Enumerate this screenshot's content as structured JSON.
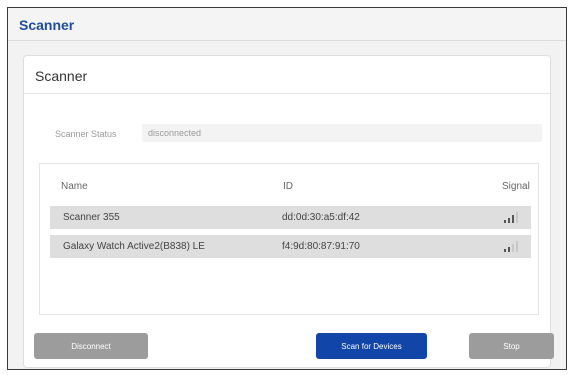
{
  "app": {
    "title": "Scanner"
  },
  "card": {
    "title": "Scanner"
  },
  "status": {
    "label": "Scanner Status",
    "value": "disconnected"
  },
  "table": {
    "columns": [
      "Name",
      "ID",
      "Signal"
    ],
    "rows": [
      {
        "name": "Scanner 355",
        "id": "dd:0d:30:a5:df:42",
        "signal_level": 3,
        "signal_icon": "signal-bars-icon"
      },
      {
        "name": "Galaxy Watch Active2(B838) LE",
        "id": "f4:9d:80:87:91:70",
        "signal_level": 2,
        "signal_icon": "signal-bars-icon"
      }
    ]
  },
  "buttons": {
    "disconnect": "Disconnect",
    "scan": "Scan for Devices",
    "stop": "Stop"
  },
  "colors": {
    "title_blue": "#1f4e9c",
    "primary_button": "#1146a8",
    "disabled_button": "#9c9c9c",
    "row_background": "#dedede"
  }
}
